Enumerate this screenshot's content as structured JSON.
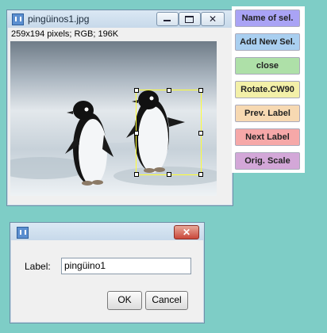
{
  "image_window": {
    "title": "pingüinos1.jpg",
    "info": "259x194 pixels; RGB; 196K"
  },
  "side_buttons": [
    {
      "label": "Name of sel.",
      "color": "#a9a3f5"
    },
    {
      "label": "Add New Sel.",
      "color": "#a9cff0"
    },
    {
      "label": "close",
      "color": "#aee0a8"
    },
    {
      "label": "Rotate.CW90",
      "color": "#f3f0a8"
    },
    {
      "label": "Prev. Label",
      "color": "#f7d9b2"
    },
    {
      "label": "Next Label",
      "color": "#f6a8a8"
    },
    {
      "label": "Orig. Scale",
      "color": "#d3a7d8"
    }
  ],
  "dialog": {
    "label_text": "Label:",
    "input_value": "pingüino1",
    "ok": "OK",
    "cancel": "Cancel",
    "close_glyph": "✕"
  },
  "window_controls": {
    "minimize": "▭",
    "restore": "▢",
    "close": "✕"
  }
}
